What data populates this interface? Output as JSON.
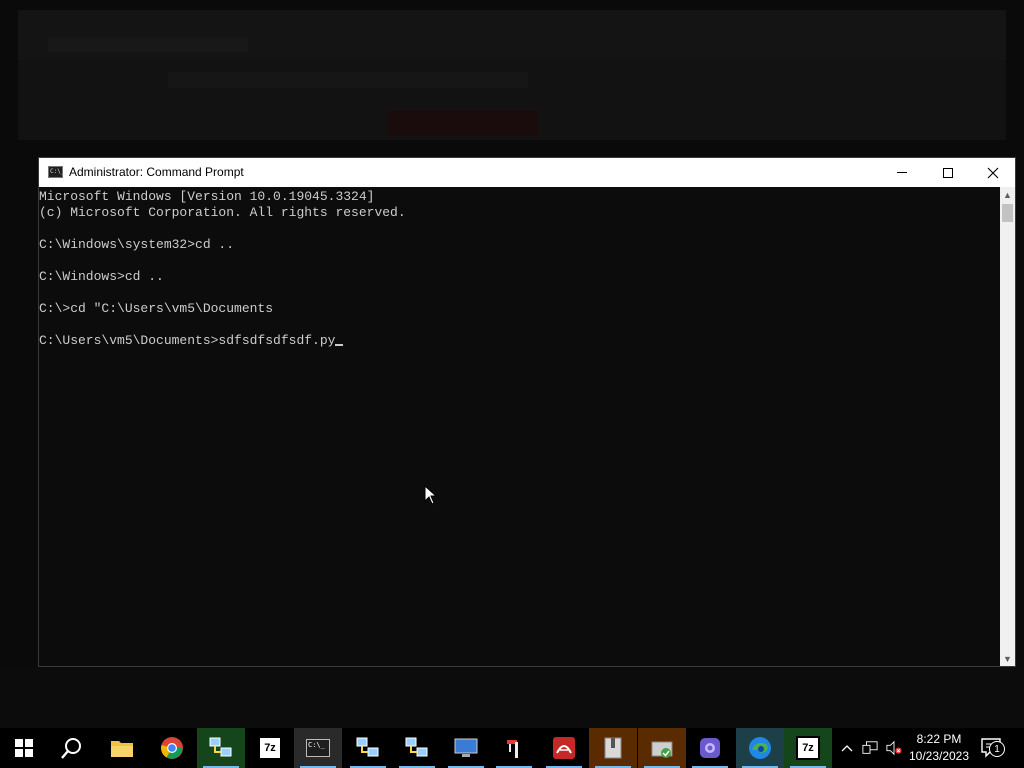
{
  "window": {
    "title": "Administrator: Command Prompt",
    "app_icon": "C:\\_"
  },
  "console": {
    "lines": [
      "Microsoft Windows [Version 10.0.19045.3324]",
      "(c) Microsoft Corporation. All rights reserved.",
      "",
      "C:\\Windows\\system32>cd ..",
      "",
      "C:\\Windows>cd ..",
      "",
      "C:\\>cd \"C:\\Users\\vm5\\Documents",
      "",
      "C:\\Users\\vm5\\Documents>sdfsdfsdfsdf.py"
    ]
  },
  "taskbar": {
    "items": [
      {
        "name": "start-button",
        "icon": "windows-logo-icon"
      },
      {
        "name": "search-button",
        "icon": "search-icon"
      },
      {
        "name": "file-explorer",
        "icon": "folder-icon"
      },
      {
        "name": "chrome",
        "icon": "chrome-icon"
      },
      {
        "name": "network-app",
        "icon": "network-computers-icon"
      },
      {
        "name": "7zip",
        "icon": "7zip-icon",
        "label": "7z"
      },
      {
        "name": "command-prompt",
        "icon": "terminal-icon",
        "label": "C:\\_"
      },
      {
        "name": "network-app-2",
        "icon": "network-computers-icon"
      },
      {
        "name": "network-app-3",
        "icon": "network-computers-icon"
      },
      {
        "name": "remote-desktop",
        "icon": "monitor-icon"
      },
      {
        "name": "tool-app",
        "icon": "tool-icon"
      },
      {
        "name": "pdf-app",
        "icon": "pdf-icon"
      },
      {
        "name": "archive-app",
        "icon": "archive-icon"
      },
      {
        "name": "installer-app",
        "icon": "installer-icon"
      },
      {
        "name": "app-purple",
        "icon": "purple-app-icon"
      },
      {
        "name": "edge",
        "icon": "edge-icon"
      },
      {
        "name": "7zip-2",
        "icon": "7zip-icon",
        "label": "7z"
      }
    ],
    "tray": {
      "time": "8:22 PM",
      "date": "10/23/2023",
      "notification_count": "1"
    }
  },
  "colors": {
    "taskbar_bg": "#000000",
    "console_bg": "#0c0c0c",
    "console_fg": "#cccccc",
    "titlebar_bg": "#ffffff"
  }
}
